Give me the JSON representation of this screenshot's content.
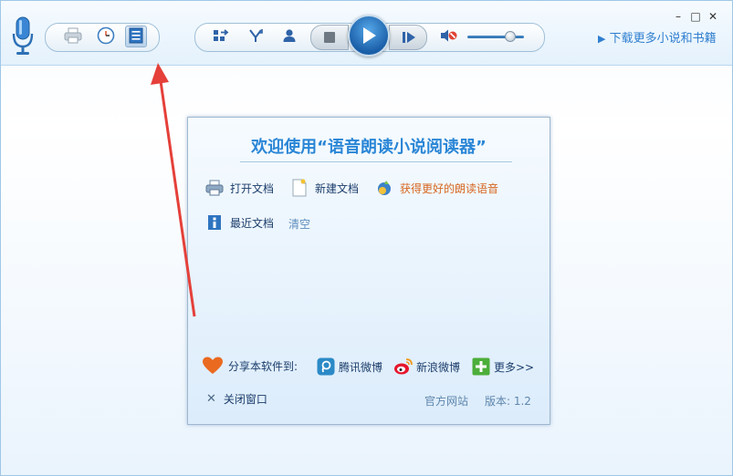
{
  "toolbar": {
    "download_link": "下载更多小说和书籍",
    "volume_level": 0.75
  },
  "window_controls": {
    "minimize_glyph": "–",
    "maximize_glyph": "□",
    "close_glyph": "✕"
  },
  "dialog": {
    "title": "欢迎使用“语音朗读小说阅读器”",
    "actions": {
      "open_doc": "打开文档",
      "new_doc": "新建文档",
      "better_voice": "获得更好的朗读语音"
    },
    "recent": {
      "label": "最近文档",
      "clear": "清空"
    },
    "share": {
      "label": "分享本软件到:",
      "tencent": "腾讯微博",
      "sina": "新浪微博",
      "more": "更多>>"
    },
    "footer": {
      "close": "关闭窗口",
      "website": "官方网站",
      "version": "版本: 1.2"
    }
  },
  "colors": {
    "accent_blue": "#2a86d6",
    "annotation_arrow": "#e5403a",
    "link_orange": "#d7661f"
  }
}
